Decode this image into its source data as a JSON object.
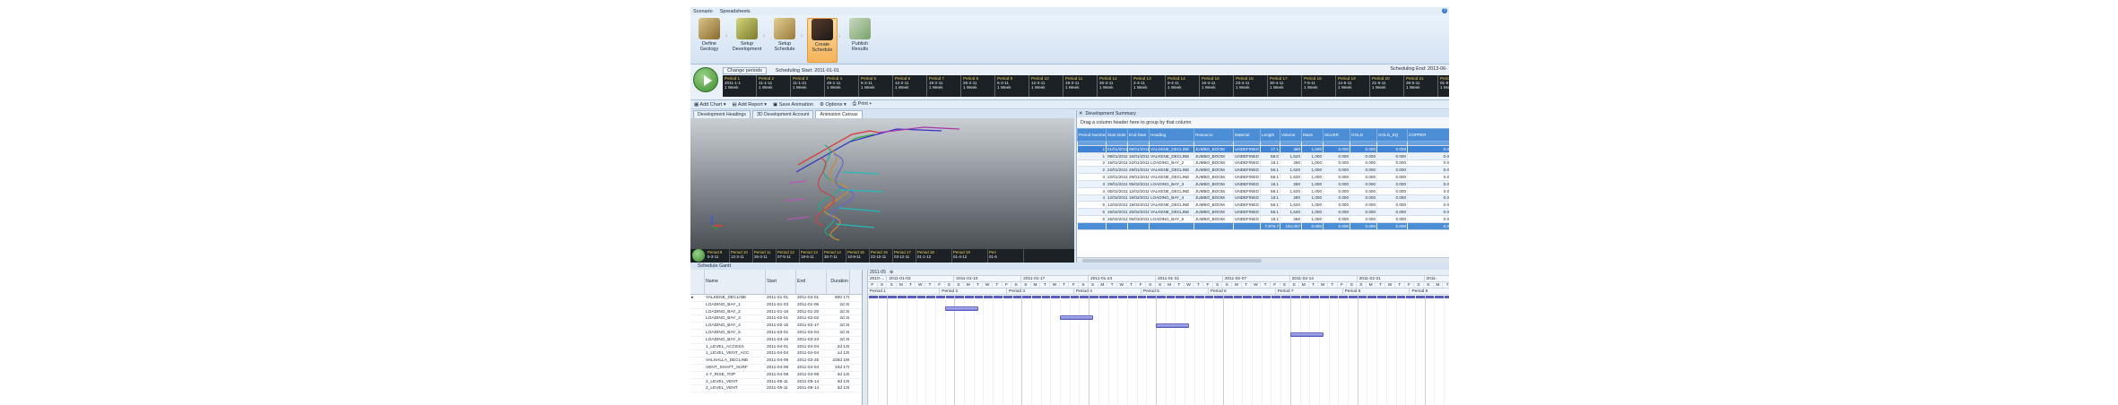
{
  "menu": [
    "Scenario",
    "Spreadsheets"
  ],
  "ribbon": [
    {
      "label": "Define Geology",
      "icon": "geology-icon",
      "active": false
    },
    {
      "label": "Setup Development",
      "icon": "development-icon",
      "active": false
    },
    {
      "label": "Setup Schedule",
      "icon": "schedule-setup-icon",
      "active": false
    },
    {
      "label": "Create Schedule",
      "icon": "create-schedule-icon",
      "active": true
    },
    {
      "label": "Publish Results",
      "icon": "publish-icon",
      "active": false
    }
  ],
  "schedule": {
    "change_periods": "Change periods",
    "start": "Scheduling Start: 2011-01-01",
    "end": "Scheduling End: 2013-06-"
  },
  "periods": [
    {
      "n": "Period 1",
      "d": "2011-1-1",
      "l": "1 Week"
    },
    {
      "n": "Period 2",
      "d": "11-1-11",
      "l": "1 Week"
    },
    {
      "n": "Period 3",
      "d": "11-1-21",
      "l": "1 Week"
    },
    {
      "n": "Period 4",
      "d": "29-1-11",
      "l": "1 Week"
    },
    {
      "n": "Period 5",
      "d": "5-2-11",
      "l": "1 Week"
    },
    {
      "n": "Period 6",
      "d": "12-2-11",
      "l": "1 Week"
    },
    {
      "n": "Period 7",
      "d": "19-2-11",
      "l": "1 Week"
    },
    {
      "n": "Period 8",
      "d": "26-2-11",
      "l": "1 Week"
    },
    {
      "n": "Period 9",
      "d": "5-3-11",
      "l": "1 Week"
    },
    {
      "n": "Period 10",
      "d": "12-3-11",
      "l": "1 Week"
    },
    {
      "n": "Period 11",
      "d": "19-3-11",
      "l": "1 Week"
    },
    {
      "n": "Period 12",
      "d": "26-3-11",
      "l": "1 Week"
    },
    {
      "n": "Period 13",
      "d": "2-4-11",
      "l": "1 Week"
    },
    {
      "n": "Period 14",
      "d": "9-4-11",
      "l": "1 Week"
    },
    {
      "n": "Period 15",
      "d": "16-4-11",
      "l": "1 Week"
    },
    {
      "n": "Period 16",
      "d": "23-4-11",
      "l": "1 Week"
    },
    {
      "n": "Period 17",
      "d": "30-4-11",
      "l": "1 Week"
    },
    {
      "n": "Period 18",
      "d": "7-5-11",
      "l": "1 Week"
    },
    {
      "n": "Period 19",
      "d": "14-5-11",
      "l": "1 Week"
    },
    {
      "n": "Period 20",
      "d": "21-5-11",
      "l": "1 Week"
    },
    {
      "n": "Period 21",
      "d": "28-5-11",
      "l": "1 Week"
    }
  ],
  "periods_wide": [
    {
      "n": "Period 34",
      "d": "01-9-11",
      "l": "1 Month"
    },
    {
      "n": "Period 35",
      "d": "01-10-11",
      "l": "1 Month"
    },
    {
      "n": "Period 36",
      "d": "01-11-11",
      "l": "1 Month"
    },
    {
      "n": "Period 37",
      "d": "01-12-11",
      "l": "1 Month"
    },
    {
      "n": "Period 38",
      "d": "01-1-12",
      "l": "1 Month"
    }
  ],
  "toolbar": [
    "Add Chart",
    "Add Report",
    "Save Animation",
    "Options",
    "Print"
  ],
  "view_tabs": [
    "Development Headings",
    "3D Development Account",
    "Animation Canvas"
  ],
  "viewport_periods": [
    {
      "n": "Period 9",
      "d": "5-3-11"
    },
    {
      "n": "Period 10",
      "d": "12-3-11"
    },
    {
      "n": "Period 11",
      "d": "26-3-11"
    },
    {
      "n": "Period 12",
      "d": "07-5-11"
    },
    {
      "n": "Period 13",
      "d": "18-6-11"
    },
    {
      "n": "Period 14",
      "d": "30-7-11"
    },
    {
      "n": "Period 15",
      "d": "10-9-11"
    },
    {
      "n": "Period 16",
      "d": "22-10-11"
    },
    {
      "n": "Period 17",
      "d": "03-12-11"
    },
    {
      "n": "Period 18",
      "d": "01-1-12"
    },
    {
      "n": "Period 19",
      "d": "01-4-12"
    },
    {
      "n": "Peri",
      "d": "01-6"
    }
  ],
  "dev_panel": {
    "title": "Development Summary",
    "group_hint": "Drag a column header here to group by that column",
    "columns": [
      "Period Number",
      "Start Date",
      "End Date",
      "Heading",
      "Resource",
      "Material",
      "Length",
      "Volume",
      "Mass",
      "SILVER",
      "GOLD",
      "GOLD_EQ",
      "COPPER"
    ],
    "rows": [
      [
        "1",
        "01/01/2011",
        "09/01/2011",
        "VALKENE_DECLINE",
        "JUMBO_BOOM",
        "UNDEFINED",
        "17.1",
        "480",
        "1,000",
        "0.000",
        "0.000",
        "0.000",
        "0.0"
      ],
      [
        "1",
        "08/01/2011",
        "15/01/2011",
        "VALKENE_DECLINE",
        "JUMBO_BOOM",
        "UNDEFINED",
        "58.0",
        "1,520",
        "1,000",
        "0.000",
        "0.000",
        "0.000",
        "0.0"
      ],
      [
        "2",
        "15/01/2011",
        "22/01/2011",
        "LOADING_BAY_2",
        "JUMBO_BOOM",
        "UNDEFINED",
        "18.1",
        "280",
        "1,000",
        "0.000",
        "0.000",
        "0.000",
        "0.0"
      ],
      [
        "2",
        "22/01/2011",
        "29/01/2011",
        "VALKENE_DECLINE",
        "JUMBO_BOOM",
        "UNDEFINED",
        "58.1",
        "1,520",
        "1,000",
        "0.000",
        "0.000",
        "0.000",
        "0.0"
      ],
      [
        "3",
        "22/01/2011",
        "29/01/2011",
        "VALKENE_DECLINE",
        "JUMBO_BOOM",
        "UNDEFINED",
        "58.1",
        "1,520",
        "1,000",
        "0.000",
        "0.000",
        "0.000",
        "0.0"
      ],
      [
        "3",
        "29/01/2011",
        "05/02/2011",
        "LOADING_BAY_3",
        "JUMBO_BOOM",
        "UNDEFINED",
        "18.1",
        "280",
        "1,000",
        "0.000",
        "0.000",
        "0.000",
        "0.0"
      ],
      [
        "4",
        "05/02/2011",
        "12/02/2011",
        "VALKENE_DECLINE",
        "JUMBO_BOOM",
        "UNDEFINED",
        "58.1",
        "1,520",
        "1,000",
        "0.000",
        "0.000",
        "0.000",
        "0.0"
      ],
      [
        "4",
        "12/02/2011",
        "19/02/2011",
        "LOADING_BAY_4",
        "JUMBO_BOOM",
        "UNDEFINED",
        "18.1",
        "280",
        "1,000",
        "0.000",
        "0.000",
        "0.000",
        "0.0"
      ],
      [
        "5",
        "12/02/2011",
        "19/02/2011",
        "VALKENE_DECLINE",
        "JUMBO_BOOM",
        "UNDEFINED",
        "58.1",
        "1,520",
        "1,000",
        "0.000",
        "0.000",
        "0.000",
        "0.0"
      ],
      [
        "5",
        "19/02/2011",
        "26/02/2011",
        "VALKENE_DECLINE",
        "JUMBO_BOOM",
        "UNDEFINED",
        "58.1",
        "1,520",
        "1,000",
        "0.000",
        "0.000",
        "0.000",
        "0.0"
      ],
      [
        "6",
        "26/02/2011",
        "05/03/2011",
        "LOADING_BAY_5",
        "JUMBO_BOOM",
        "UNDEFINED",
        "18.1",
        "280",
        "1,000",
        "0.000",
        "0.000",
        "0.000",
        "0.0"
      ]
    ],
    "totals": [
      "",
      "",
      "",
      "",
      "",
      "",
      "7,976.7",
      "184,087",
      "0.000",
      "0.000",
      "0.000",
      "0.000",
      "0.0"
    ]
  },
  "gantt": {
    "title": "Schedule Gantt",
    "columns": [
      "",
      "Name",
      "Start",
      "End",
      "Duration"
    ],
    "rows": [
      [
        "VALKENE_DECLINE",
        "2011-01-01",
        "2011-04-01",
        "900 17t"
      ],
      [
        "LOADING_BAY_1",
        "2011-01-03",
        "2011-01-06",
        "2d 3t"
      ],
      [
        "LOADING_BAY_2",
        "2011-01-16",
        "2011-01-20",
        "2d 3t"
      ],
      [
        "LOADING_BAY_3",
        "2011-02-01",
        "2011-02-02",
        "2d 3t"
      ],
      [
        "LOADING_BAY_4",
        "2011-02-15",
        "2011-02-17",
        "2d 3t"
      ],
      [
        "LOADING_BAY_5",
        "2011-03-01",
        "2011-03-04",
        "2d 3t"
      ],
      [
        "LOADING_BAY_6",
        "2011-03-16",
        "2011-03-23",
        "2d 3t"
      ],
      [
        "1_LEVEL_ACCESS",
        "2011-04-01",
        "2011-04-04",
        "2d 13t"
      ],
      [
        "1_LEVEL_VENT_ACC",
        "2011-04-04",
        "2011-04-04",
        "1d 13t"
      ],
      [
        "VALHALLA_DECLINE",
        "2011-04-06",
        "2011-02-25",
        "226d 19t"
      ],
      [
        "VENT_SHAFT_SURF",
        "2011-04-06",
        "2011-04-04",
        "34d 17t"
      ],
      [
        "1-7_RISE_TOP",
        "2011-04-08",
        "2011-04-08",
        "3d 13t"
      ],
      [
        "2_LEVEL_VENT",
        "2011-05-11",
        "2011-09-14",
        "3d 13t"
      ],
      [
        "2_LEVEL_VENT",
        "2011-05-11",
        "2011-09-14",
        "3d 13t"
      ]
    ],
    "year_label": "2011-05",
    "weeks": [
      "2010-...",
      "2011-01-03",
      "2011-01-10",
      "2011-01-17",
      "2011-01-24",
      "2011-01-31",
      "2011-02-07",
      "2011-02-14",
      "2011-02-21",
      "2011-"
    ],
    "day_letters": [
      "S",
      "M",
      "T",
      "W",
      "T",
      "F",
      "S"
    ],
    "period_labels": [
      "Period 1",
      "Period 2",
      "Period 3",
      "Period 4",
      "Period 5",
      "Period 6",
      "Period 7",
      "Period 8",
      "Period 9"
    ]
  },
  "colors": {
    "accent": "#4b8ed6",
    "active_ribbon": "#f5b45a",
    "gantt_bar": "#7b7fd9"
  }
}
